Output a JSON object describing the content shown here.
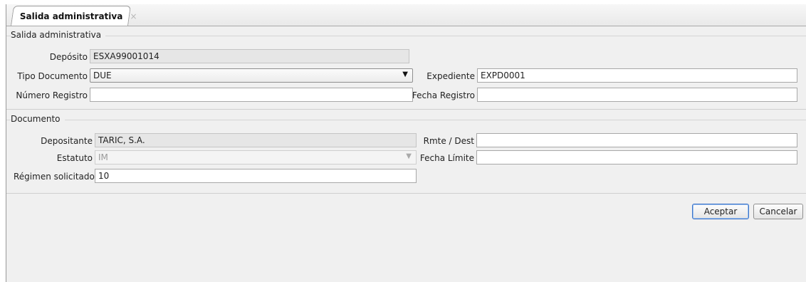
{
  "tab": {
    "title": "Salida administrativa",
    "close_glyph": "×"
  },
  "section1": {
    "title": "Salida administrativa",
    "deposito": {
      "label": "Depósito",
      "value": "ESXA99001014"
    },
    "tipo_documento": {
      "label": "Tipo Documento",
      "value": "DUE"
    },
    "expediente": {
      "label": "Expediente",
      "value": "EXPD0001"
    },
    "numero_registro": {
      "label": "Número Registro",
      "value": ""
    },
    "fecha_registro": {
      "label": "Fecha Registro",
      "value": ""
    }
  },
  "section2": {
    "title": "Documento",
    "depositante": {
      "label": "Depositante",
      "value": "TARIC, S.A."
    },
    "rmte_dest": {
      "label": "Rmte / Dest",
      "value": ""
    },
    "estatuto": {
      "label": "Estatuto",
      "value": "IM"
    },
    "fecha_limite": {
      "label": "Fecha Límite",
      "value": ""
    },
    "regimen": {
      "label": "Régimen solicitado",
      "value": "10"
    }
  },
  "buttons": {
    "accept": "Aceptar",
    "cancel": "Cancelar"
  },
  "icons": {
    "dropdown": "▼"
  }
}
